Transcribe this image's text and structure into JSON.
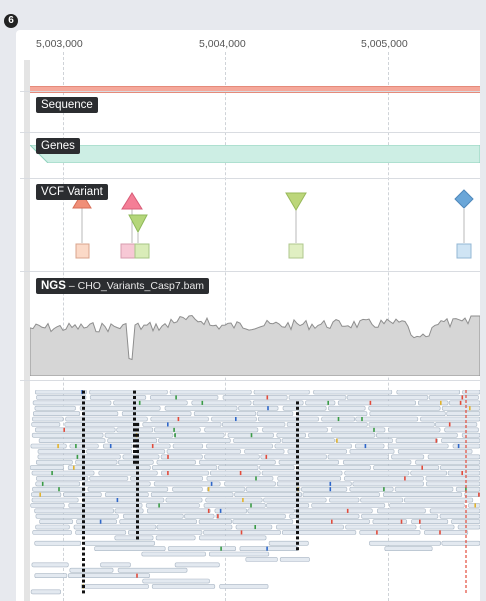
{
  "badge": "6",
  "ruler": {
    "ticks": [
      "5,003,000",
      "5,004,000",
      "5,005,000"
    ]
  },
  "tracks": {
    "sequence": {
      "label": "Sequence"
    },
    "genes": {
      "label": "Genes"
    },
    "vcf": {
      "label": "VCF Variant"
    },
    "ngs": {
      "label_bold": "NGS",
      "label_sep": " – ",
      "file": "CHO_Variants_Casp7.bam"
    }
  },
  "colors": {
    "sequence_bar": "#f5a89a",
    "gene_fill": "#cdeee4",
    "coverage_fill": "#d6d6d6",
    "read_fill": "#e3e9f0",
    "read_stroke": "#a9b6c4"
  },
  "variants": [
    {
      "shape": "triangle-up",
      "color": "#f08f78",
      "box_color": "#fbd9c7"
    },
    {
      "shape": "triangle-up",
      "color": "#f47e96",
      "box_color": "#f7c8d5"
    },
    {
      "shape": "triangle-down",
      "color": "#b4d67a",
      "box_color": "#d9ecb8"
    },
    {
      "shape": "triangle-down",
      "color": "#bcd67a",
      "box_color": "#e0efc2"
    },
    {
      "shape": "diamond",
      "color": "#6aa6d8",
      "box_color": "#cfe4f4"
    }
  ]
}
